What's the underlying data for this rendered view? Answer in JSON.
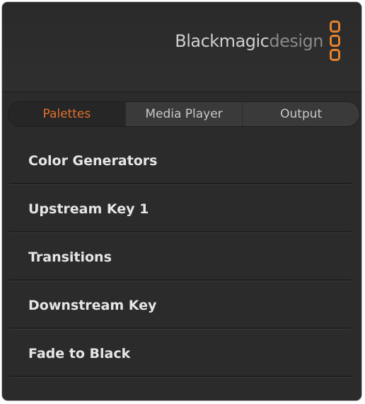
{
  "brand": {
    "name_bold": "Blackmagic",
    "name_light": "design",
    "mark_color": "#e6832d"
  },
  "tabs": [
    {
      "label": "Palettes",
      "active": true
    },
    {
      "label": "Media Player",
      "active": false
    },
    {
      "label": "Output",
      "active": false
    }
  ],
  "menu": [
    {
      "label": "Color Generators"
    },
    {
      "label": "Upstream Key 1"
    },
    {
      "label": "Transitions"
    },
    {
      "label": "Downstream Key"
    },
    {
      "label": "Fade to Black"
    }
  ],
  "colors": {
    "accent": "#e4702c",
    "panel_bg": "#2b2b2b",
    "text": "#e6e6e6"
  }
}
